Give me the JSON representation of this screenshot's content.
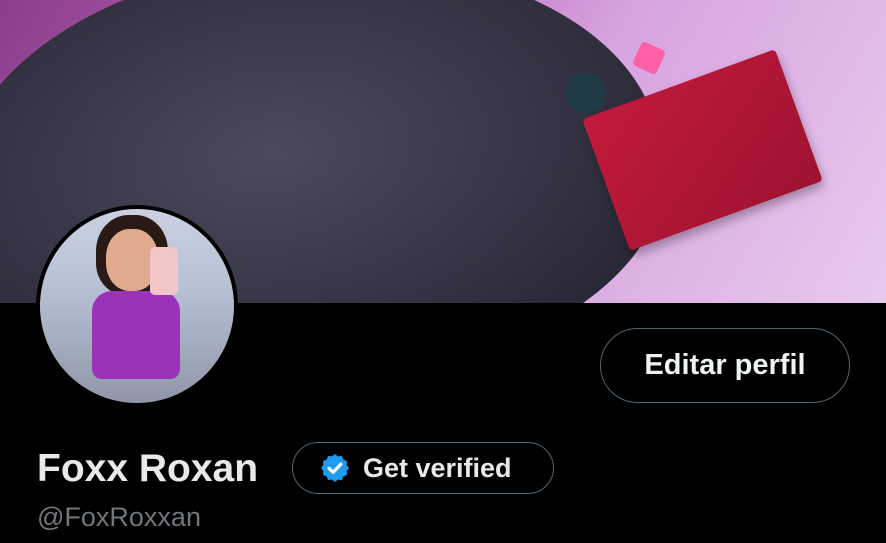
{
  "profile": {
    "name": "Foxx Roxan",
    "handle": "@FoxRoxxan",
    "edit_label": "Editar perfil",
    "verify_label": "Get verified",
    "verify_icon": "verified-badge-icon"
  },
  "colors": {
    "background": "#000000",
    "button_border": "#536471",
    "text_primary": "#e7e9ea",
    "text_secondary": "#71767b",
    "verified_blue": "#1d9bf0"
  }
}
